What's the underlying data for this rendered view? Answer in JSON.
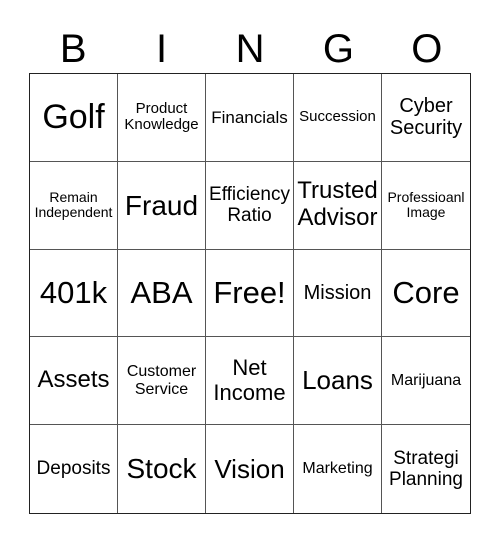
{
  "header": [
    "B",
    "I",
    "N",
    "G",
    "O"
  ],
  "cells": [
    [
      "Golf",
      "Product Knowledge",
      "Financials",
      "Succession",
      "Cyber Security"
    ],
    [
      "Remain Independent",
      "Fraud",
      "Efficiency Ratio",
      "Trusted Advisor",
      "Professioanl Image"
    ],
    [
      "401k",
      "ABA",
      "Free!",
      "Mission",
      "Core"
    ],
    [
      "Assets",
      "Customer Service",
      "Net Income",
      "Loans",
      "Marijuana"
    ],
    [
      "Deposits",
      "Stock",
      "Vision",
      "Marketing",
      "Strategi Planning"
    ]
  ]
}
